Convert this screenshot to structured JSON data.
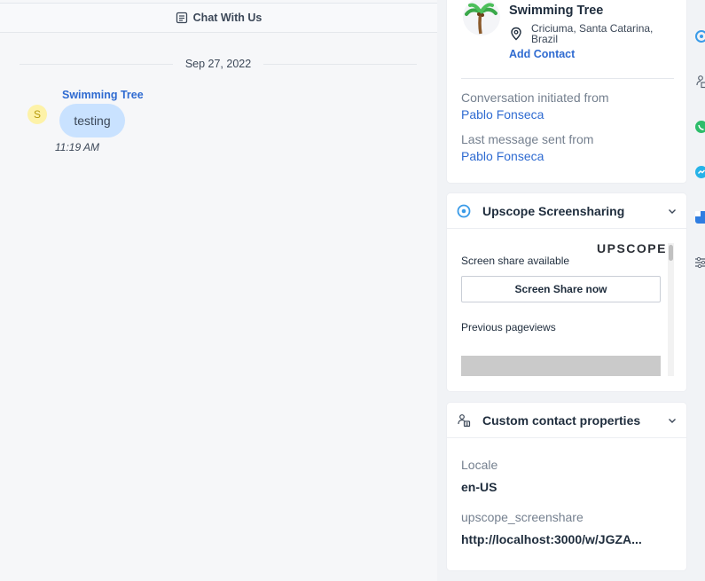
{
  "chat": {
    "header_title": "Chat With Us",
    "date": "Sep 27, 2022",
    "message": {
      "sender": "Swimming Tree",
      "avatar_initial": "S",
      "text": "testing",
      "time": "11:19 AM"
    }
  },
  "contact": {
    "name": "Swimming Tree",
    "avatar_icon": "palm-tree-icon",
    "location_line1": "Criciuma, Santa Catarina,",
    "location_line2": "Brazil",
    "add_contact": "Add Contact",
    "initiated_label": "Conversation initiated from",
    "initiated_value": "Pablo Fonseca",
    "last_message_label": "Last message sent from",
    "last_message_value": "Pablo Fonseca"
  },
  "upscope": {
    "title": "Upscope Screensharing",
    "logo": "UPSCOPE",
    "available": "Screen share available",
    "button": "Screen Share now",
    "previous": "Previous pageviews"
  },
  "custom": {
    "title": "Custom contact properties",
    "props": [
      {
        "label": "Locale",
        "value": "en-US"
      },
      {
        "label": "upscope_screenshare",
        "value": "http://localhost:3000/w/JGZA..."
      }
    ]
  },
  "colors": {
    "link": "#2f6bd1",
    "bubble": "#c9e2ff",
    "avatar_bg": "#fdf2a8",
    "upscope_blue": "#3a9be8",
    "edge_green": "#2ebd6b",
    "edge_cyan": "#27b3e8",
    "edge_blue": "#2f7de1"
  },
  "edge_icons": [
    "upscope-icon",
    "contact-props-icon",
    "whatsapp-icon",
    "messenger-icon",
    "app-icon",
    "settings-sliders-icon"
  ]
}
